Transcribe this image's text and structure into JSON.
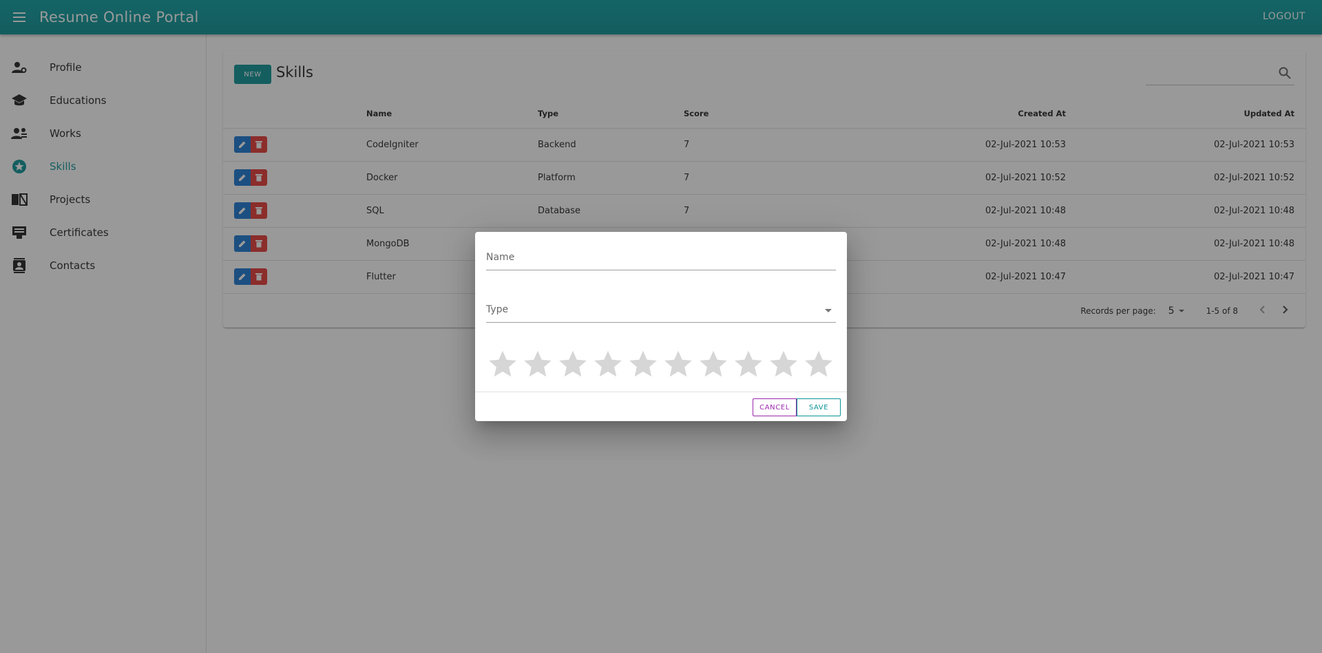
{
  "app": {
    "title": "Resume Online Portal",
    "logout_label": "LOGOUT"
  },
  "sidebar": {
    "items": [
      {
        "label": "Profile",
        "icon": "person-gear-icon"
      },
      {
        "label": "Educations",
        "icon": "school-icon"
      },
      {
        "label": "Works",
        "icon": "people-icon"
      },
      {
        "label": "Skills",
        "icon": "star-circle-icon",
        "active": true
      },
      {
        "label": "Projects",
        "icon": "book-icon"
      },
      {
        "label": "Certificates",
        "icon": "certificate-icon"
      },
      {
        "label": "Contacts",
        "icon": "contacts-icon"
      }
    ]
  },
  "card": {
    "new_label": "NEW",
    "title": "Skills"
  },
  "table": {
    "columns": [
      "Name",
      "Type",
      "Score",
      "Created At",
      "Updated At"
    ],
    "rows": [
      {
        "name": "CodeIgniter",
        "type": "Backend",
        "score": "7",
        "created": "02-Jul-2021 10:53",
        "updated": "02-Jul-2021 10:53"
      },
      {
        "name": "Docker",
        "type": "Platform",
        "score": "7",
        "created": "02-Jul-2021 10:52",
        "updated": "02-Jul-2021 10:52"
      },
      {
        "name": "SQL",
        "type": "Database",
        "score": "7",
        "created": "02-Jul-2021 10:48",
        "updated": "02-Jul-2021 10:48"
      },
      {
        "name": "MongoDB",
        "type": "",
        "score": "",
        "created": "02-Jul-2021 10:48",
        "updated": "02-Jul-2021 10:48"
      },
      {
        "name": "Flutter",
        "type": "",
        "score": "",
        "created": "02-Jul-2021 10:47",
        "updated": "02-Jul-2021 10:47"
      }
    ]
  },
  "footer": {
    "records_per_page_label": "Records per page:",
    "records_per_page_value": "5",
    "range": "1-5 of 8"
  },
  "dialog": {
    "name_label": "Name",
    "type_label": "Type",
    "rating": {
      "value": 0,
      "max": 10
    },
    "cancel_label": "CANCEL",
    "save_label": "SAVE"
  },
  "colors": {
    "primary": "#0a9396",
    "edit": "#1976d2",
    "delete": "#e53935",
    "cancel": "#9c27b0"
  }
}
